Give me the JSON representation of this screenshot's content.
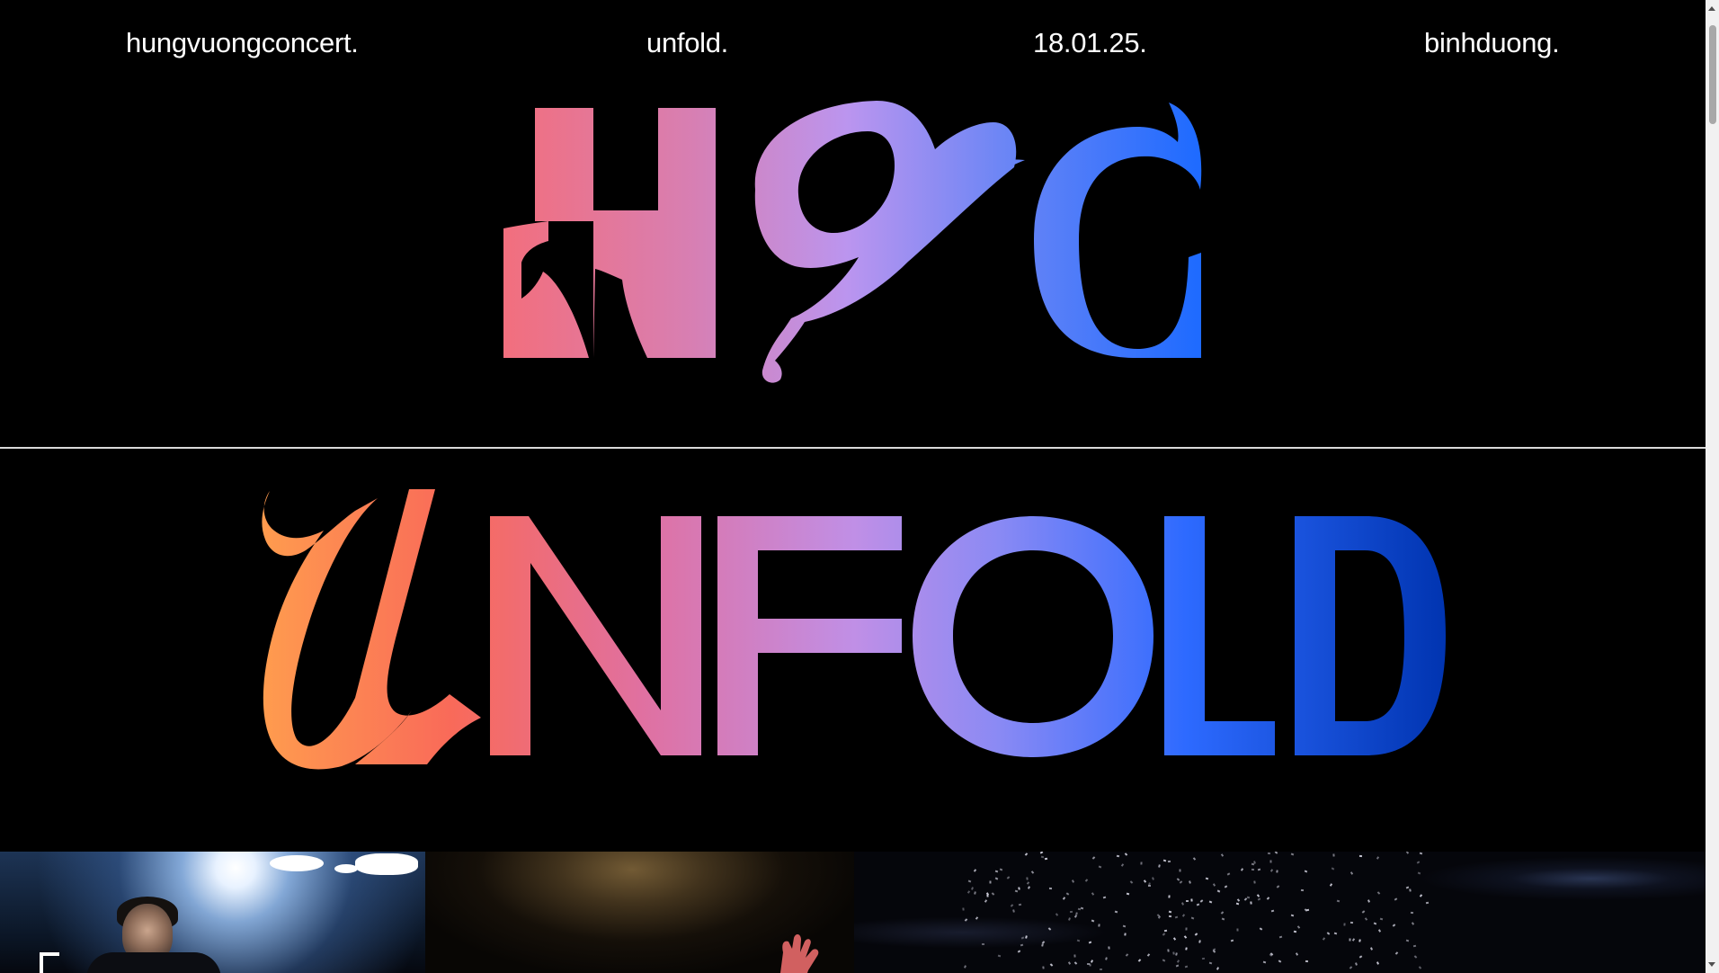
{
  "nav": {
    "items": [
      {
        "label": "hungvuongconcert."
      },
      {
        "label": "unfold."
      },
      {
        "label": "18.01.25."
      },
      {
        "label": "binhduong."
      }
    ]
  },
  "hero": {
    "monogram_text": "HVC",
    "title_text": "UNFOLD"
  },
  "colors": {
    "background": "#000000",
    "text": "#ffffff",
    "gradient_orange": "#ff9a4f",
    "gradient_coral": "#f26a5f",
    "gradient_pink": "#d27bb4",
    "gradient_lavender": "#bd93f0",
    "gradient_blue": "#3f72ff",
    "gradient_deep_blue": "#0039b8",
    "divider": "#d9d9d9"
  },
  "gallery": {
    "photos": [
      {
        "name": "concert-photo-performer"
      },
      {
        "name": "concert-photo-stage-smoke"
      },
      {
        "name": "concert-photo-confetti"
      }
    ]
  },
  "scrollbar": {
    "thumb_icon": "scrollbar-thumb"
  }
}
